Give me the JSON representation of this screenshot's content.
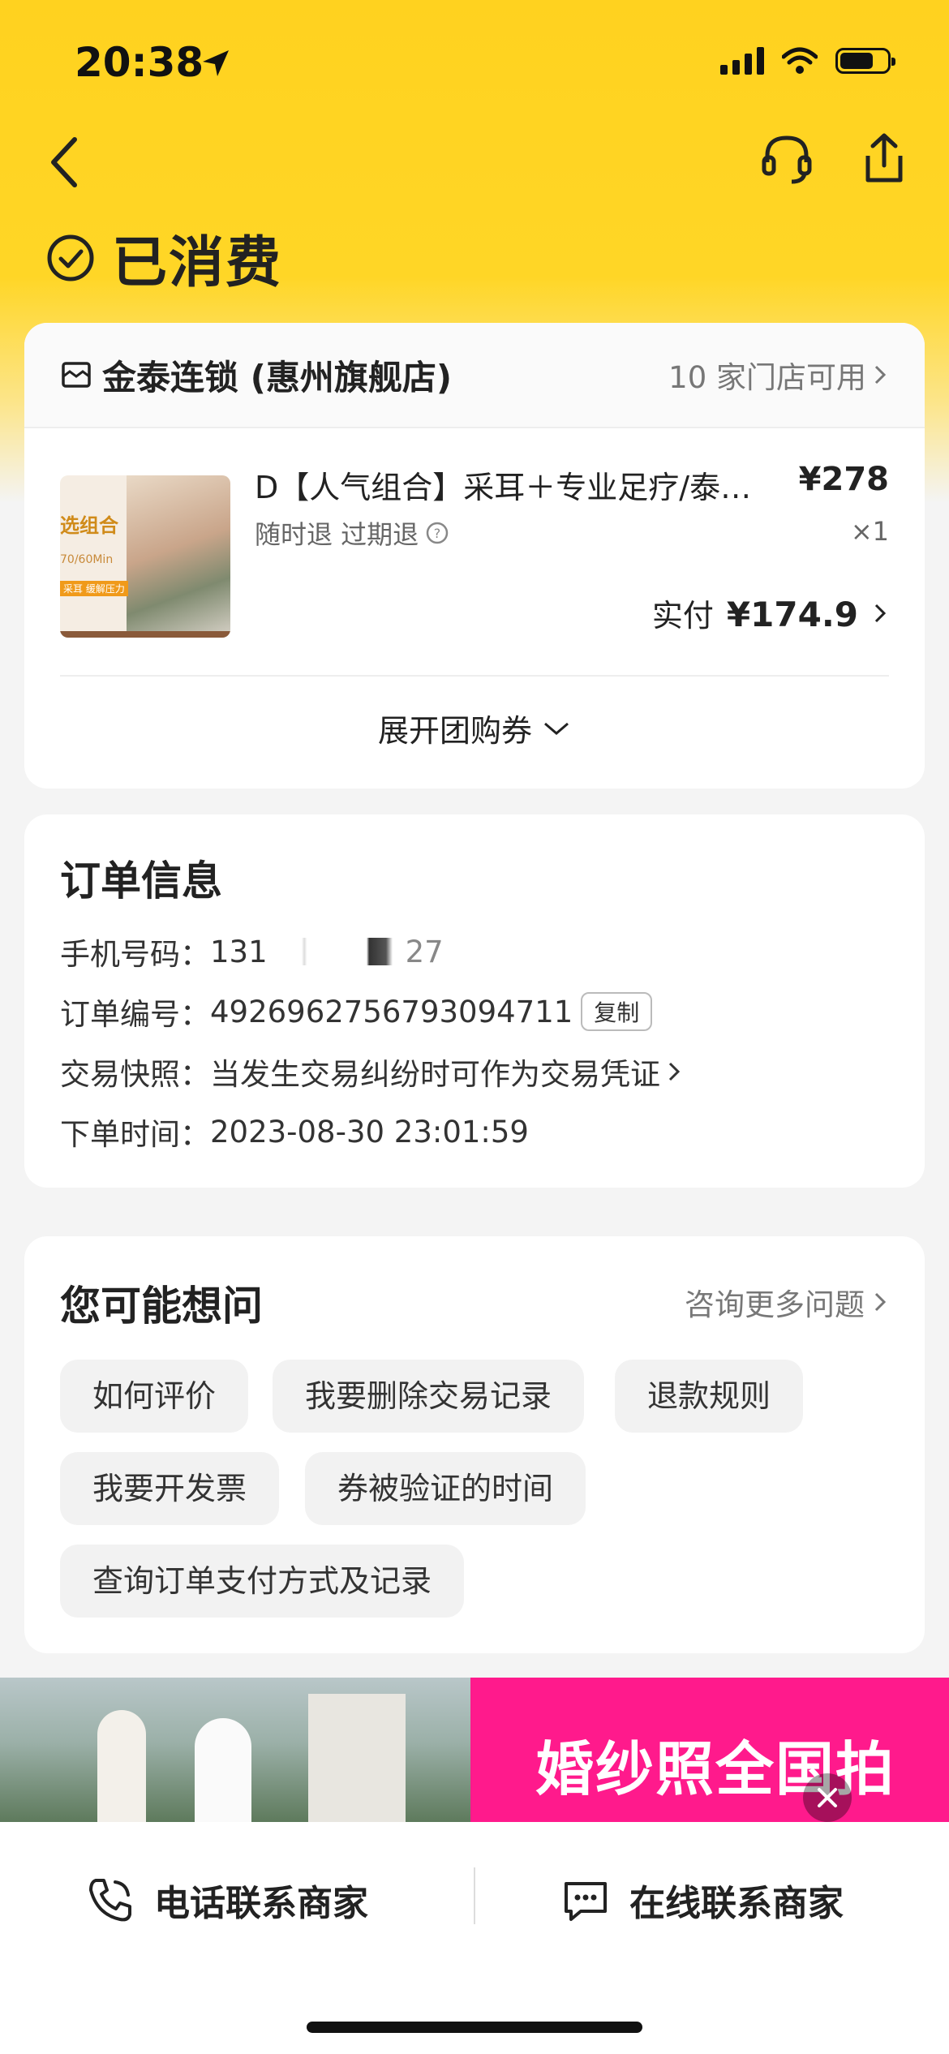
{
  "status_bar": {
    "time": "20:38"
  },
  "header": {
    "status_label": "已消费"
  },
  "store": {
    "name": "金泰连锁 (惠州旗舰店)",
    "availability": "10 家门店可用",
    "product": {
      "thumb_text": "选组合",
      "thumb_sub": "70/60Min",
      "thumb_badge": "采耳 缓解压力",
      "title": "D【人气组合】采耳＋专业足疗/泰…",
      "price": "¥278",
      "tags": "随时退 过期退",
      "quantity": "×1",
      "paid_label": "实付",
      "paid_amount": "¥174.9"
    },
    "expand_label": "展开团购券"
  },
  "order_info": {
    "title": "订单信息",
    "phone_label": "手机号码：",
    "phone_value": "131",
    "phone_tail": "27",
    "order_no_label": "订单编号：",
    "order_no_value": "4926962756793094711",
    "copy_label": "复制",
    "snapshot_label": "交易快照：",
    "snapshot_value": "当发生交易纠纷时可作为交易凭证",
    "time_label": "下单时间：",
    "time_value": "2023-08-30 23:01:59"
  },
  "faq": {
    "title": "您可能想问",
    "more_label": "咨询更多问题",
    "chips": [
      "如何评价",
      "我要删除交易记录",
      "退款规则",
      "我要开发票",
      "券被验证的时间",
      "查询订单支付方式及记录"
    ]
  },
  "banner": {
    "text": "婚纱照全国拍"
  },
  "bottom_actions": {
    "call_label": "电话联系商家",
    "chat_label": "在线联系商家"
  },
  "colors": {
    "brand_yellow": "#ffd21f",
    "banner_pink": "#ff1a8c"
  }
}
